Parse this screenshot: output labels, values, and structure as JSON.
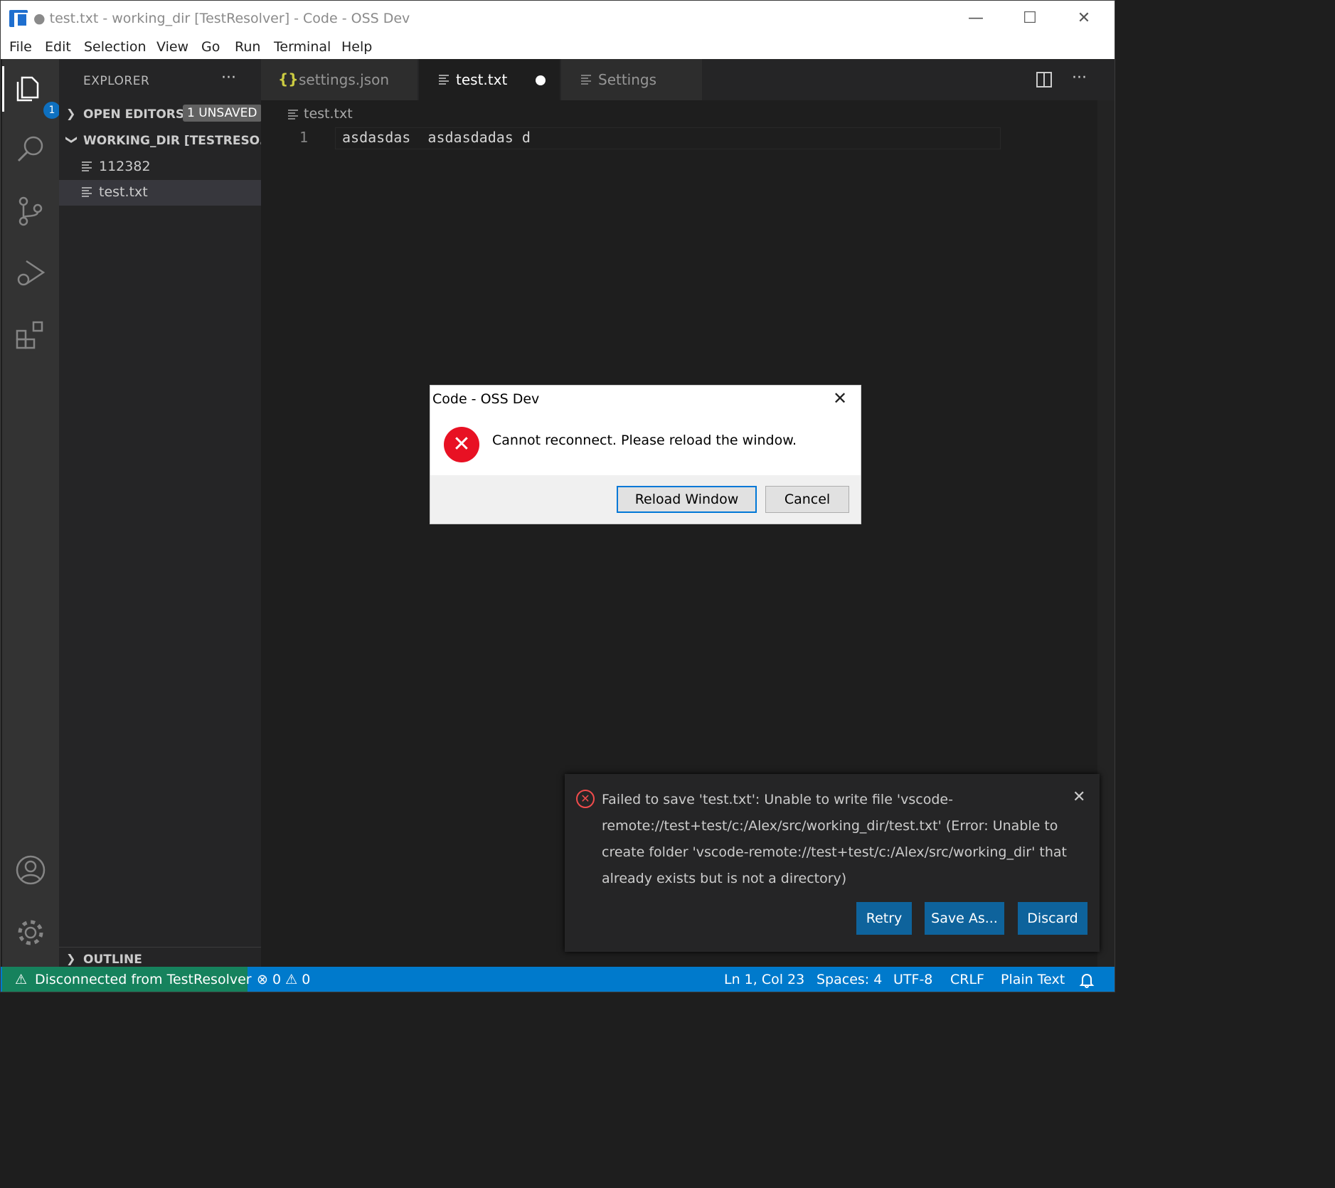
{
  "window": {
    "title": "● test.txt - working_dir [TestResolver] - Code - OSS Dev",
    "controls": {
      "minimize": "—",
      "maximize": "☐",
      "close": "✕"
    }
  },
  "menu": [
    "File",
    "Edit",
    "Selection",
    "View",
    "Go",
    "Run",
    "Terminal",
    "Help"
  ],
  "activity_bar": {
    "items": [
      "explorer-icon",
      "search-icon",
      "source-control-icon",
      "run-debug-icon",
      "extensions-icon",
      "account-icon",
      "gear-icon"
    ],
    "explorer_badge": "1"
  },
  "sidebar": {
    "title": "EXPLORER",
    "more": "···",
    "open_editors": {
      "label": "OPEN EDITORS",
      "badge": "1 UNSAVED"
    },
    "workspace": {
      "label": "WORKING_DIR [TESTRESO...",
      "files": [
        "112382",
        "test.txt"
      ]
    },
    "outline": {
      "label": "OUTLINE"
    }
  },
  "tabs": [
    {
      "label": "settings.json",
      "icon": "{}"
    },
    {
      "label": "test.txt",
      "icon": "lines-icon",
      "dirty": true,
      "active": true
    },
    {
      "label": "Settings",
      "icon": "lines-icon"
    }
  ],
  "editor_actions": {
    "split": "split-editor-icon",
    "more": "···"
  },
  "editor": {
    "breadcrumb": "test.txt",
    "lines": [
      {
        "number": "1",
        "text": "asdasdas  asdasdadas d"
      }
    ]
  },
  "dialog": {
    "title": "Code - OSS Dev",
    "close": "✕",
    "message": "Cannot reconnect. Please reload the window.",
    "primary_button": "Reload Window",
    "cancel_button": "Cancel",
    "error_color": "#e81123"
  },
  "notification": {
    "message": "Failed to save 'test.txt': Unable to write file 'vscode-remote://test+test/c:/Alex/src/working_dir/test.txt' (Error: Unable to create folder 'vscode-remote://test+test/c:/Alex/src/working_dir' that already exists but is not a directory)",
    "close": "✕",
    "buttons": [
      "Retry",
      "Save As...",
      "Discard"
    ]
  },
  "statusbar": {
    "remote": "Disconnected from TestResolver",
    "errors": "0",
    "warnings": "0",
    "position": "Ln 1, Col 23",
    "indent": "Spaces: 4",
    "encoding": "UTF-8",
    "eol": "CRLF",
    "language": "Plain Text",
    "colors": {
      "background": "#007acc",
      "remote_background": "#16825d"
    }
  }
}
